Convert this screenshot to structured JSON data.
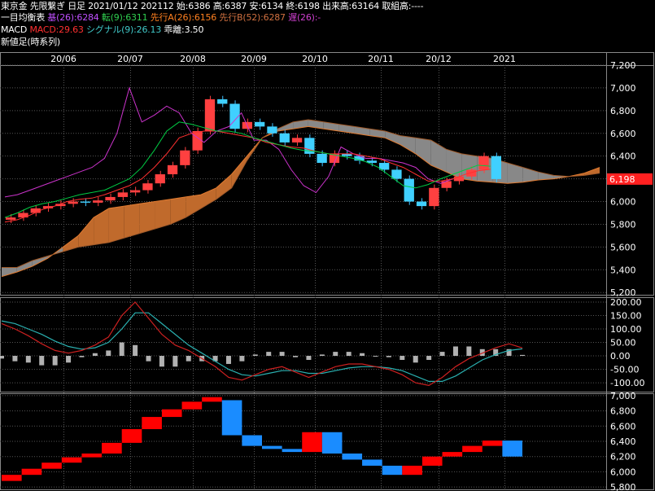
{
  "header": {
    "line1": {
      "market": "東京金",
      "contract": "先限繋ぎ",
      "period": "日足",
      "date": "2021/01/12",
      "month": "202112",
      "open_label": "始:",
      "open": "6386",
      "high_label": "高:",
      "high": "6387",
      "low_label": "安:",
      "low": "6134",
      "close_label": "終:",
      "close": "6198",
      "volume_label": "出来高:",
      "volume": "63164",
      "oi_label": "取組高:",
      "oi": "----"
    },
    "line2": {
      "title": "一目均衡表",
      "kijun_label": "基(26):",
      "kijun": "6284",
      "tenkan_label": "転(9):",
      "tenkan": "6311",
      "spanA_label": "先行A(26):",
      "spanA": "6156",
      "spanB_label": "先行B(52):",
      "spanB": "6287",
      "chikou_label": "遅(26):",
      "chikou": "-"
    },
    "line3": {
      "title": "MACD",
      "macd_label": "MACD:",
      "macd": "29.63",
      "signal_label": "シグナル(9):",
      "signal": "26.13",
      "osc_label": "乖離:",
      "osc": "3.50"
    },
    "line4": {
      "title": "新値足(時系列)"
    }
  },
  "colors": {
    "up": "#ff0000",
    "down": "#00aaff",
    "kijun": "#ff3030",
    "tenkan": "#00cc44",
    "chikou": "#cc33cc",
    "cloud_bull": "#c06a2c",
    "cloud_bear": "#888888",
    "macd": "#cc2020",
    "signal": "#2ab0b0",
    "osc": "#d0d0d0",
    "price_tag": "#ff2020"
  },
  "chart_data": [
    {
      "type": "candlestick",
      "title": "一目均衡表",
      "x_ticks": [
        "20/06",
        "20/07",
        "20/08",
        "20/09",
        "20/10",
        "20/11",
        "20/12",
        "2021"
      ],
      "y_ticks": [
        5200,
        5400,
        5600,
        5800,
        6000,
        6200,
        6400,
        6600,
        6800,
        7000,
        7200
      ],
      "y_tick_labels": [
        "5,200",
        "5,400",
        "5,600",
        "5,800",
        "6,000",
        "6,200",
        "6,400",
        "6,600",
        "6,800",
        "7,000",
        "7,200"
      ],
      "ylim": [
        5180,
        7200
      ],
      "last_price": 6198,
      "last_price_label": "6,198",
      "series": [
        {
          "name": "基(26)",
          "values": [
            5820,
            5840,
            5880,
            5930,
            5960,
            6000,
            6020,
            6030,
            6060,
            6100,
            6140,
            6200,
            6300,
            6420,
            6560,
            6600,
            6620,
            6620,
            6600,
            6580,
            6560,
            6520,
            6500,
            6480,
            6470,
            6440,
            6420,
            6420,
            6420,
            6400,
            6380,
            6340,
            6300,
            6240,
            6180,
            6180,
            6200,
            6240,
            6270,
            6284
          ]
        },
        {
          "name": "転(9)",
          "values": [
            5860,
            5900,
            5950,
            5980,
            6000,
            6030,
            6060,
            6080,
            6100,
            6150,
            6200,
            6300,
            6450,
            6620,
            6700,
            6680,
            6650,
            6620,
            6620,
            6600,
            6560,
            6530,
            6500,
            6470,
            6450,
            6440,
            6420,
            6400,
            6380,
            6350,
            6300,
            6220,
            6140,
            6120,
            6150,
            6200,
            6240,
            6280,
            6320,
            6311
          ]
        },
        {
          "name": "遅(26)",
          "values": [
            6040,
            6060,
            6100,
            6140,
            6180,
            6220,
            6260,
            6300,
            6380,
            6600,
            7000,
            6700,
            6760,
            6840,
            6780,
            6600,
            6520,
            6620,
            6660,
            6780,
            6540,
            6540,
            6460,
            6280,
            6140,
            6080,
            6220,
            6480,
            6420,
            6380,
            6380,
            6360,
            6340,
            6300,
            6200,
            6160,
            6200
          ]
        },
        {
          "name": "先行A(26)",
          "values": [
            5340,
            5380,
            5430,
            5500,
            5600,
            5700,
            5860,
            5940,
            5960,
            5980,
            6000,
            6020,
            6040,
            6060,
            6120,
            6240,
            6400,
            6560,
            6620,
            6640,
            6660,
            6640,
            6620,
            6600,
            6580,
            6560,
            6500,
            6420,
            6320,
            6260,
            6200,
            6180,
            6170,
            6160,
            6170,
            6190,
            6200,
            6220,
            6250,
            6300
          ]
        },
        {
          "name": "先行B(52)",
          "values": [
            5420,
            5420,
            5480,
            5520,
            5560,
            5600,
            5620,
            5640,
            5680,
            5720,
            5760,
            5800,
            5860,
            5940,
            6020,
            6120,
            6360,
            6560,
            6640,
            6700,
            6720,
            6700,
            6680,
            6660,
            6640,
            6620,
            6580,
            6560,
            6540,
            6460,
            6420,
            6400,
            6380,
            6340,
            6300,
            6260,
            6230,
            6220,
            6230,
            6250
          ]
        }
      ],
      "candles_close": [
        5860,
        5900,
        5940,
        5960,
        5980,
        6000,
        5990,
        6010,
        6040,
        6080,
        6100,
        6160,
        6240,
        6320,
        6450,
        6620,
        6900,
        6860,
        6640,
        6700,
        6660,
        6600,
        6520,
        6560,
        6420,
        6340,
        6420,
        6400,
        6360,
        6340,
        6280,
        6200,
        6000,
        5960,
        6120,
        6180,
        6220,
        6280,
        6400,
        6198
      ]
    },
    {
      "type": "line",
      "title": "MACD",
      "y_ticks": [
        -100,
        -50,
        0,
        50,
        100,
        150,
        200
      ],
      "y_tick_labels": [
        "-100.00",
        "-50.00",
        "0.00",
        "50.00",
        "100.00",
        "150.00",
        "200.00"
      ],
      "ylim": [
        -130,
        215
      ],
      "series": [
        {
          "name": "MACD",
          "values": [
            120,
            100,
            75,
            45,
            20,
            10,
            20,
            40,
            70,
            150,
            200,
            140,
            80,
            40,
            20,
            -10,
            -40,
            -80,
            -90,
            -70,
            -50,
            -40,
            -60,
            -80,
            -60,
            -40,
            -30,
            -30,
            -40,
            -50,
            -70,
            -100,
            -110,
            -80,
            -40,
            -10,
            10,
            30,
            45,
            29.63
          ]
        },
        {
          "name": "シグナル(9)",
          "values": [
            130,
            120,
            100,
            80,
            55,
            35,
            25,
            30,
            50,
            100,
            160,
            160,
            120,
            80,
            40,
            10,
            -20,
            -50,
            -70,
            -75,
            -65,
            -55,
            -55,
            -65,
            -65,
            -55,
            -45,
            -40,
            -40,
            -45,
            -55,
            -75,
            -95,
            -95,
            -75,
            -45,
            -15,
            5,
            20,
            26.13
          ]
        },
        {
          "name": "乖離",
          "values": [
            -10,
            -20,
            -25,
            -35,
            -35,
            -25,
            -5,
            10,
            20,
            50,
            40,
            -20,
            -40,
            -40,
            -20,
            -20,
            -20,
            -30,
            -20,
            5,
            15,
            15,
            -5,
            -15,
            5,
            15,
            15,
            10,
            0,
            -5,
            -15,
            -25,
            -15,
            15,
            35,
            35,
            25,
            25,
            25,
            3.5
          ]
        }
      ]
    },
    {
      "type": "bar",
      "title": "新値足(時系列)",
      "y_ticks": [
        5800,
        6000,
        6200,
        6400,
        6600,
        6800,
        7000
      ],
      "y_tick_labels": [
        "5,800",
        "6,000",
        "6,200",
        "6,400",
        "6,600",
        "6,800",
        "7,000"
      ],
      "ylim": [
        5780,
        7020
      ],
      "bricks": [
        {
          "dir": "up",
          "from": 5880,
          "to": 5960
        },
        {
          "dir": "up",
          "from": 5960,
          "to": 6040
        },
        {
          "dir": "up",
          "from": 6040,
          "to": 6120
        },
        {
          "dir": "up",
          "from": 6120,
          "to": 6190
        },
        {
          "dir": "up",
          "from": 6190,
          "to": 6240
        },
        {
          "dir": "up",
          "from": 6240,
          "to": 6380
        },
        {
          "dir": "up",
          "from": 6380,
          "to": 6560
        },
        {
          "dir": "up",
          "from": 6560,
          "to": 6720
        },
        {
          "dir": "up",
          "from": 6720,
          "to": 6820
        },
        {
          "dir": "up",
          "from": 6820,
          "to": 6920
        },
        {
          "dir": "up",
          "from": 6920,
          "to": 6980
        },
        {
          "dir": "down",
          "from": 6940,
          "to": 6480
        },
        {
          "dir": "down",
          "from": 6480,
          "to": 6340
        },
        {
          "dir": "down",
          "from": 6340,
          "to": 6300
        },
        {
          "dir": "down",
          "from": 6300,
          "to": 6260
        },
        {
          "dir": "up",
          "from": 6260,
          "to": 6520
        },
        {
          "dir": "down",
          "from": 6520,
          "to": 6240
        },
        {
          "dir": "down",
          "from": 6240,
          "to": 6160
        },
        {
          "dir": "down",
          "from": 6160,
          "to": 6080
        },
        {
          "dir": "down",
          "from": 6080,
          "to": 5960
        },
        {
          "dir": "up",
          "from": 5960,
          "to": 6080
        },
        {
          "dir": "up",
          "from": 6080,
          "to": 6200
        },
        {
          "dir": "up",
          "from": 6200,
          "to": 6260
        },
        {
          "dir": "up",
          "from": 6260,
          "to": 6340
        },
        {
          "dir": "up",
          "from": 6340,
          "to": 6410
        },
        {
          "dir": "down",
          "from": 6410,
          "to": 6200
        }
      ]
    }
  ]
}
